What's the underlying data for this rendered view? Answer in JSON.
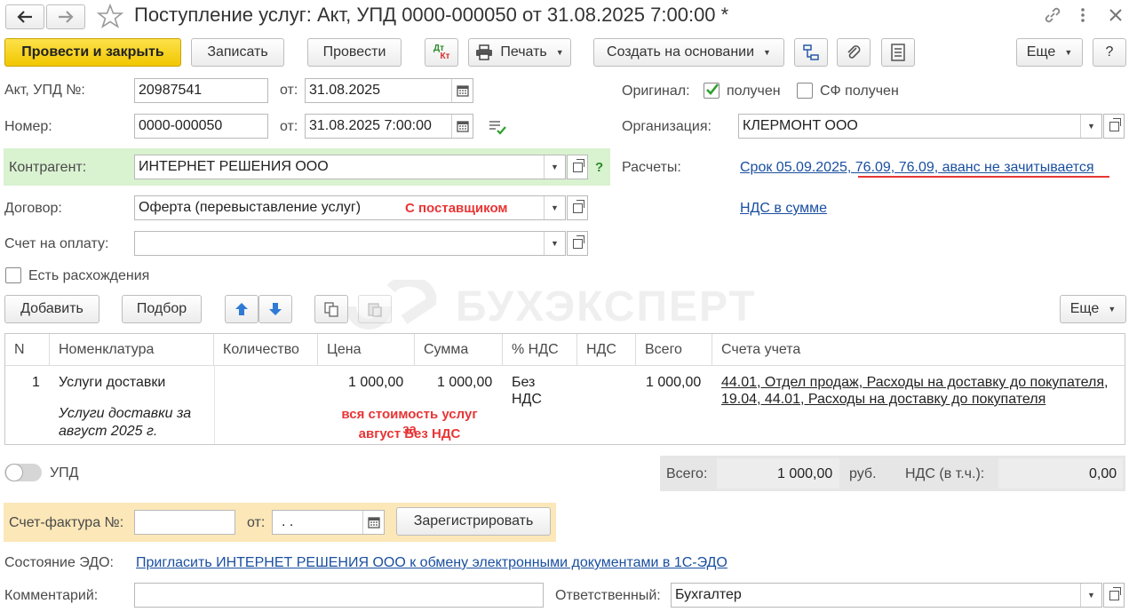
{
  "title": "Поступление услуг: Акт, УПД 0000-000050 от 31.08.2025 7:00:00 *",
  "toolbar": {
    "post_close": "Провести и закрыть",
    "save": "Записать",
    "post": "Провести",
    "dtkt_top": "Дт",
    "dtkt_bottom": "Кт",
    "print": "Печать",
    "create_based": "Создать на основании",
    "more": "Еще",
    "help": "?"
  },
  "form": {
    "act_label": "Акт, УПД №:",
    "act_number": "20987541",
    "from_label": "от:",
    "act_date": "31.08.2025",
    "number_label": "Номер:",
    "number_value": "0000-000050",
    "number_date": "31.08.2025  7:00:00",
    "counterparty_label": "Контрагент:",
    "counterparty_value": "ИНТЕРНЕТ РЕШЕНИЯ ООО",
    "counterparty_help": "?",
    "contract_label": "Договор:",
    "contract_value": "Оферта (перевыставление услуг)",
    "contract_note": "С поставщиком",
    "invoice_label": "Счет на оплату:",
    "invoice_value": "",
    "discrepancy_label": "Есть расхождения",
    "original_label": "Оригинал:",
    "received_label": "получен",
    "sf_received_label": "СФ получен",
    "org_label": "Организация:",
    "org_value": "КЛЕРМОНТ ООО",
    "settlements_label": "Расчеты:",
    "settlements_link": "Срок 05.09.2025, 76.09, 76.09, аванс не зачитывается",
    "vat_link": "НДС в сумме"
  },
  "table_toolbar": {
    "add": "Добавить",
    "select": "Подбор",
    "more": "Еще"
  },
  "watermark": "БУХЭКСПЕРТ",
  "table": {
    "headers": [
      "N",
      "Номенклатура",
      "Количество",
      "Цена",
      "Сумма",
      "% НДС",
      "НДС",
      "Всего",
      "Счета учета"
    ],
    "rows": [
      {
        "n": "1",
        "item": "Услуги доставки",
        "item_desc_1": "Услуги доставки за",
        "item_desc_2": "август 2025 г.",
        "qty": "",
        "price": "1 000,00",
        "sum": "1 000,00",
        "vat_rate_1": "Без",
        "vat_rate_2": "НДС",
        "vat": "",
        "total": "1 000,00",
        "accounts_1": "44.01, Отдел продаж, Расходы на доставку до покупателя,",
        "accounts_2": "19.04, 44.01, Расходы на доставку до покупателя"
      }
    ],
    "note_1": "вся стоимость услуг за",
    "note_2": "август Без НДС"
  },
  "footer": {
    "upd_label": "УПД",
    "total_label": "Всего:",
    "total_value": "1 000,00",
    "currency": "руб.",
    "vat_label": "НДС (в т.ч.):",
    "vat_value": "0,00",
    "sf_label": "Счет-фактура №:",
    "sf_number": "",
    "sf_from_label": "от:",
    "sf_date": " .  .",
    "register": "Зарегистрировать",
    "edo_label": "Состояние ЭДО:",
    "edo_link": "Пригласить ИНТЕРНЕТ РЕШЕНИЯ ООО к обмену электронными документами в 1С-ЭДО",
    "comment_label": "Комментарий:",
    "comment_value": "",
    "responsible_label": "Ответственный:",
    "responsible_value": "Бухгалтер"
  },
  "colors": {
    "primary": "#f5cd1a",
    "counterparty_bg": "#d9f2d0",
    "invoice_bg": "#fbe7b8",
    "note_red": "#e83535",
    "link": "#1a4fa0",
    "totals_bg": "#e6e6e6"
  },
  "icons": [
    "back-arrow-icon",
    "forward-arrow-icon",
    "star-icon",
    "link-icon",
    "kebab-icon",
    "close-icon",
    "printer-icon",
    "structure-icon",
    "paperclip-icon",
    "list-icon",
    "calendar-icon",
    "move-up-icon",
    "move-down-icon",
    "copy-icon",
    "paste-icon"
  ]
}
